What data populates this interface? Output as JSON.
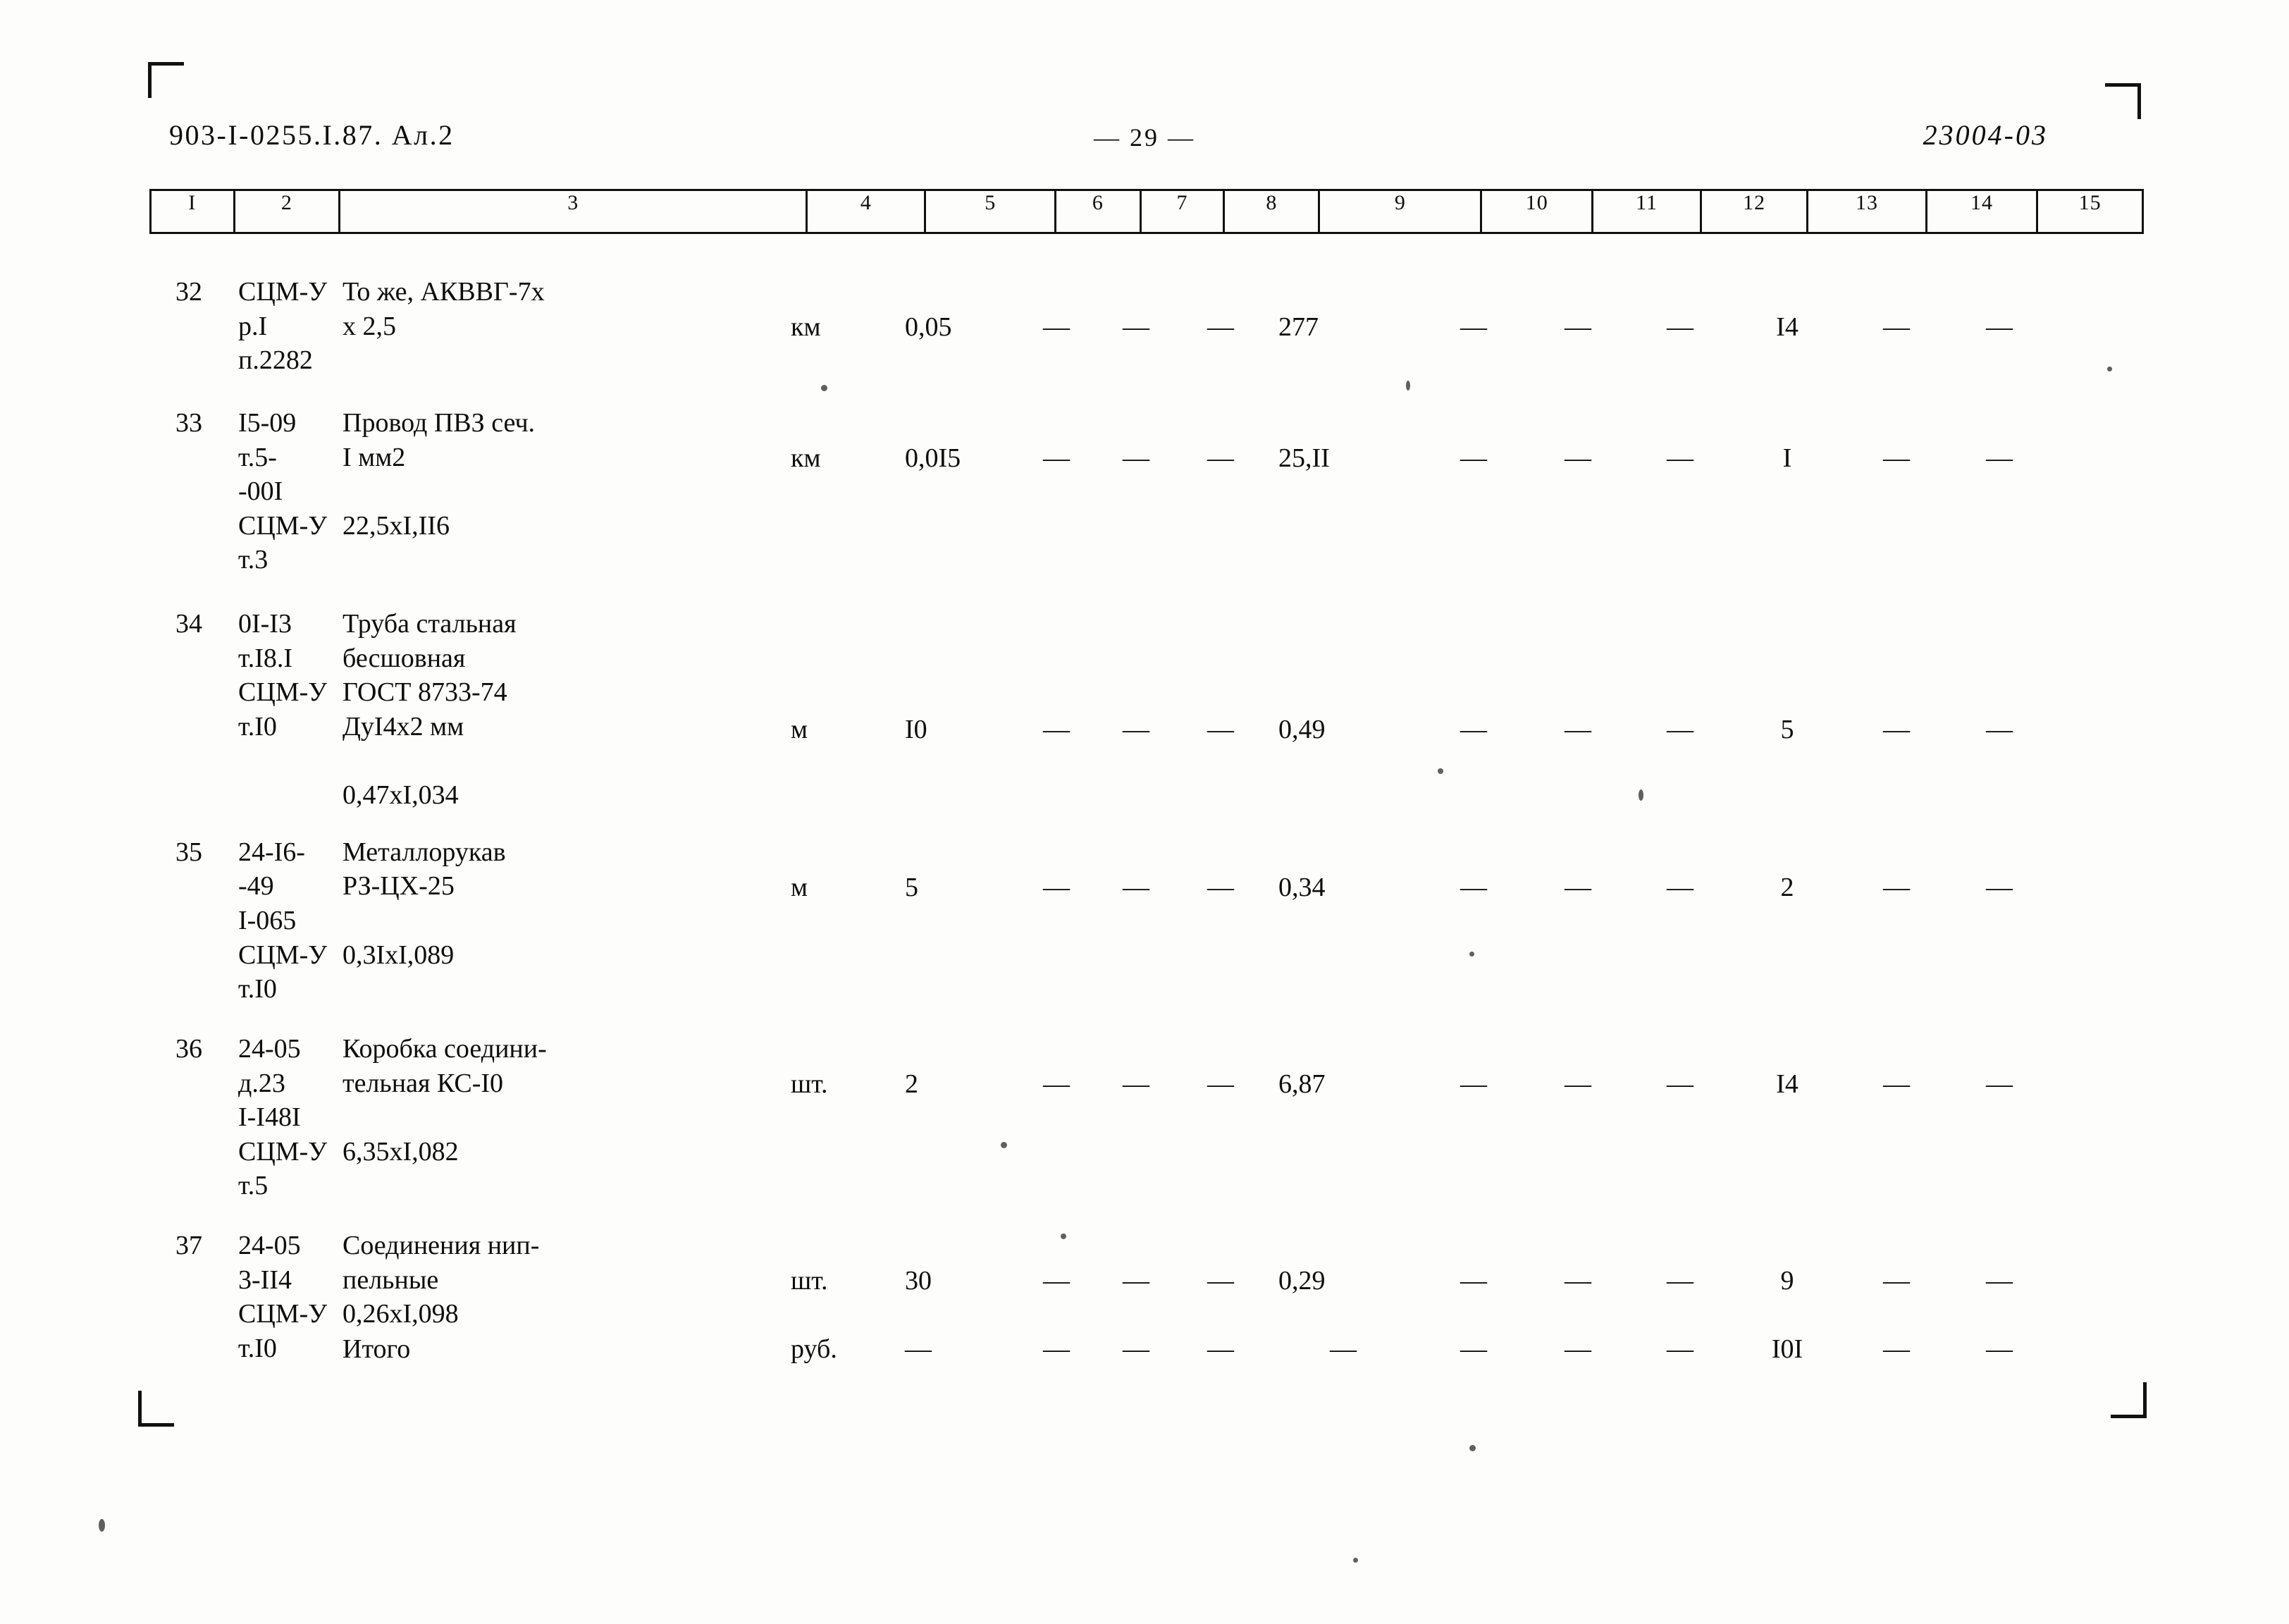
{
  "header": {
    "left_code": "903-I-0255.I.87. Ал.2",
    "page_marker": "— 29 —",
    "right_code": "23004-03"
  },
  "table": {
    "column_numbers": [
      "I",
      "2",
      "3",
      "4",
      "5",
      "6",
      "7",
      "8",
      "9",
      "10",
      "11",
      "12",
      "13",
      "14",
      "15"
    ],
    "dash": "—",
    "rows": [
      {
        "num": "32",
        "code": "СЦМ-У\nр.I\nп.2282",
        "name": "То же, АКВВГ-7х\nх 2,5",
        "unit": "км",
        "c5": "0,05",
        "c6": "—",
        "c7": "—",
        "c8": "—",
        "c9": "277",
        "c10": "—",
        "c11": "—",
        "c12": "—",
        "c13": "I4",
        "c14": "—",
        "c15": "—"
      },
      {
        "num": "33",
        "code": "I5-09\nт.5-\n-00I\nСЦМ-У\nт.3",
        "name": "Провод ПВЗ сеч.\nI мм2\n\n22,5хI,II6",
        "unit": "км",
        "c5": "0,0I5",
        "c6": "—",
        "c7": "—",
        "c8": "—",
        "c9": "25,II",
        "c10": "—",
        "c11": "—",
        "c12": "—",
        "c13": "I",
        "c14": "—",
        "c15": "—"
      },
      {
        "num": "34",
        "code": "0I-I3\nт.I8.I\nСЦМ-У\nт.I0",
        "name": "Труба стальная\nбесшовная\nГОСТ 8733-74\nДуI4х2 мм\n\n0,47хI,034",
        "unit": "м",
        "c5": "I0",
        "c6": "—",
        "c7": "—",
        "c8": "—",
        "c9": "0,49",
        "c10": "—",
        "c11": "—",
        "c12": "—",
        "c13": "5",
        "c14": "—",
        "c15": "—"
      },
      {
        "num": "35",
        "code": "24-I6-\n-49\nI-065\nСЦМ-У\nт.I0",
        "name": "Металлорукав\nРЗ-ЦХ-25\n\n0,3IхI,089",
        "unit": "м",
        "c5": "5",
        "c6": "—",
        "c7": "—",
        "c8": "—",
        "c9": "0,34",
        "c10": "—",
        "c11": "—",
        "c12": "—",
        "c13": "2",
        "c14": "—",
        "c15": "—"
      },
      {
        "num": "36",
        "code": "24-05\nд.23\nI-I48I\nСЦМ-У\nт.5",
        "name": "Коробка соедини-\nтельная КС-I0\n\n6,35хI,082",
        "unit": "шт.",
        "c5": "2",
        "c6": "—",
        "c7": "—",
        "c8": "—",
        "c9": "6,87",
        "c10": "—",
        "c11": "—",
        "c12": "—",
        "c13": "I4",
        "c14": "—",
        "c15": "—"
      },
      {
        "num": "37",
        "code": "24-05\n3-II4\nСЦМ-У\nт.I0",
        "name": "Соединения нип-\nпельные\n0,26хI,098",
        "unit": "шт.",
        "c5": "30",
        "c6": "—",
        "c7": "—",
        "c8": "—",
        "c9": "0,29",
        "c10": "—",
        "c11": "—",
        "c12": "—",
        "c13": "9",
        "c14": "—",
        "c15": "—"
      },
      {
        "num": "",
        "code": "",
        "name": "Итого",
        "unit": "руб.",
        "c5": "—",
        "c6": "—",
        "c7": "—",
        "c8": "—",
        "c9": "—",
        "c10": "—",
        "c11": "—",
        "c12": "—",
        "c13": "I0I",
        "c14": "—",
        "c15": "—"
      }
    ]
  }
}
